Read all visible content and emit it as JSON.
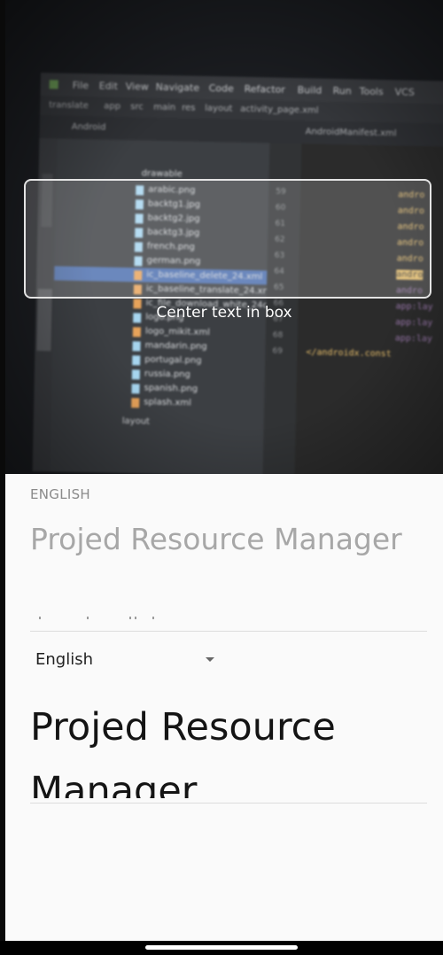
{
  "camera": {
    "hint": "Center text in box",
    "ide": {
      "menu": [
        "File",
        "Edit",
        "View",
        "Navigate",
        "Code",
        "Refactor",
        "Build",
        "Run",
        "Tools",
        "VCS"
      ],
      "breadcrumb": [
        "translate",
        "app",
        "src",
        "main",
        "res",
        "layout",
        "activity_page.xml"
      ],
      "toolbar": [
        "Android",
        "AndroidManifest.xml"
      ],
      "folder": "drawable",
      "files": [
        "arabic.png",
        "backtg1.jpg",
        "backtg2.jpg",
        "backtg3.jpg",
        "french.png",
        "german.png",
        "ic_baseline_delete_24.xml",
        "ic_baseline_translate_24.xml",
        "ic_file_download_white_24dp.xml",
        "logo.png",
        "logo_mikit.xml",
        "mandarin.png",
        "portugal.png",
        "russia.png",
        "spanish.png",
        "splash.xml"
      ],
      "layout_folder": "layout",
      "line_numbers": [
        "59",
        "60",
        "61",
        "62",
        "63",
        "64",
        "65",
        "66",
        "67",
        "68",
        "69"
      ],
      "code": [
        "andro",
        "andro",
        "andro",
        "andro",
        "andro",
        "andro",
        "andro",
        "app:lay",
        "app:lay",
        "app:lay",
        "</androidx.const"
      ]
    }
  },
  "source": {
    "language_label": "ENGLISH",
    "text": "Projed Resource Manager"
  },
  "target": {
    "language": "English",
    "text": "Projed Resource Manager"
  },
  "colors": {
    "accent_box": "#e3e3e3",
    "panel_bg": "#fafafa"
  }
}
